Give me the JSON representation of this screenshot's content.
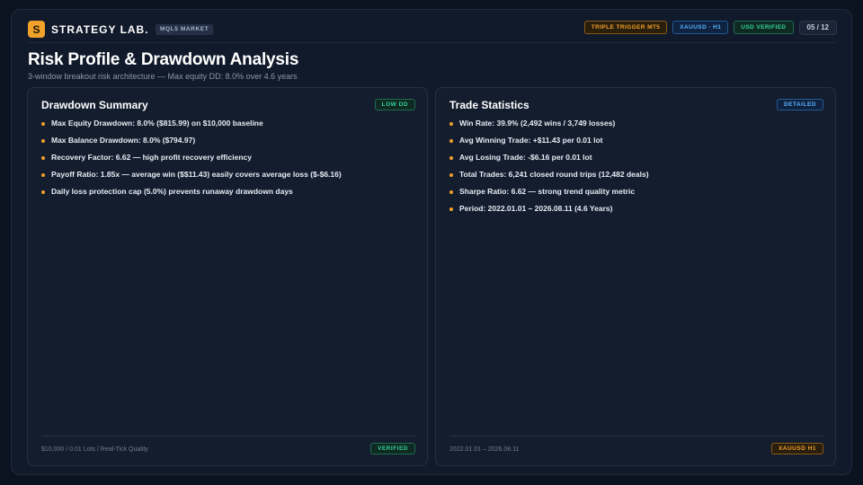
{
  "header": {
    "logo_letter": "S",
    "brand": "STRATEGY LAB.",
    "market_tag": "MQL5 MARKET",
    "chips": [
      {
        "label": "TRIPLE TRIGGER MT5",
        "color": "#f0a12a"
      },
      {
        "label": "XAUUSD · H1",
        "color": "#5bb0ff"
      },
      {
        "label": "USD VERIFIED",
        "color": "#34d399"
      }
    ],
    "page": "05 / 12"
  },
  "page": {
    "title": "Risk Profile & Drawdown Analysis",
    "subtitle": "3-window breakout risk architecture — Max equity DD: 8.0% over 4.6 years"
  },
  "panels": {
    "left": {
      "title": "Drawdown Summary",
      "badge": "LOW DD",
      "bullets": [
        "Max Equity Drawdown: 8.0% ($815.99) on $10,000 baseline",
        "Max Balance Drawdown: 8.0% ($794.97)",
        "Recovery Factor: 6.62 — high profit recovery efficiency",
        "Payoff Ratio: 1.85x — average win ($$11.43) easily covers average loss ($-$6.16)",
        "Daily loss protection cap (5.0%) prevents runaway drawdown days"
      ],
      "footer": "$10,000 / 0.01 Lots / Real-Tick Quality",
      "footer_badge": "VERIFIED"
    },
    "right": {
      "title": "Trade Statistics",
      "badge": "DETAILED",
      "bullets": [
        "Win Rate: 39.9% (2,492 wins / 3,749 losses)",
        "Avg Winning Trade: +$11.43 per 0.01 lot",
        "Avg Losing Trade: -$6.16 per 0.01 lot",
        "Total Trades: 6,241 closed round trips (12,482 deals)",
        "Sharpe Ratio: 6.62 — strong trend quality metric",
        "Period: 2022.01.01 – 2026.08.11 (4.6 Years)"
      ],
      "footer": "2022.01.01 – 2026.08.11",
      "footer_badge": "XAUUSD H1"
    }
  },
  "colors": {
    "accent": "#f0a12a",
    "blue": "#5bb0ff",
    "green": "#34d399",
    "background": "#0b1220"
  }
}
